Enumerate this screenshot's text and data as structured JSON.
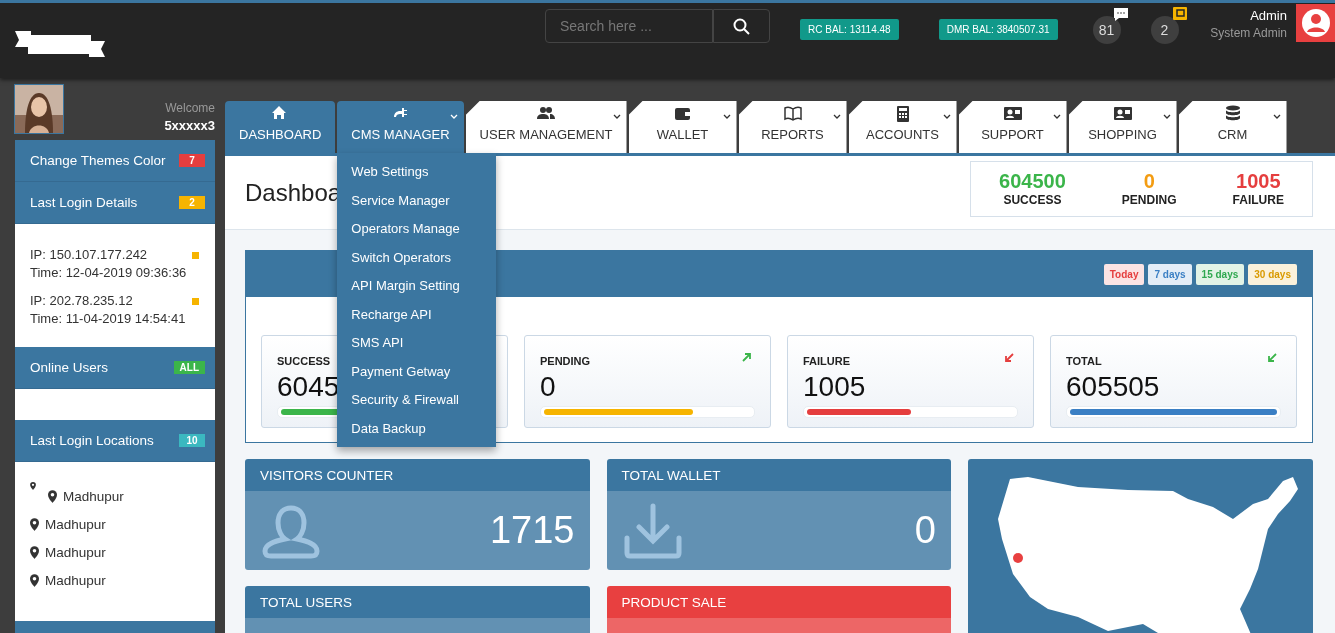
{
  "header": {
    "search": {
      "placeholder": "Search here ..."
    },
    "balances": [
      "RC BAL: 13114.48",
      "DMR BAL: 3840507.31"
    ],
    "notifications": [
      {
        "kind": "messages",
        "count": "81"
      },
      {
        "kind": "wallet",
        "count": "2"
      }
    ],
    "user": {
      "name": "Admin",
      "role": "System Admin"
    }
  },
  "sidebar": {
    "welcome": "Welcome",
    "username": "5xxxxx3",
    "panels": [
      {
        "title": "Change Themes Color",
        "badge": {
          "text": "7",
          "color": "#e53e3e"
        },
        "kind": "none"
      },
      {
        "title": "Last Login Details",
        "badge": {
          "text": "2",
          "color": "#f6b400"
        },
        "kind": "logins",
        "items": [
          {
            "ip": "IP: 150.107.177.242",
            "time": "Time: 12-04-2019 09:36:36",
            "color": "#f6b400"
          },
          {
            "ip": "IP: 202.78.235.12",
            "time": "Time: 11-04-2019 14:54:41",
            "color": "#f6b400"
          }
        ]
      },
      {
        "title": "Online Users",
        "badge": {
          "text": "ALL",
          "color": "#3bb54a"
        },
        "kind": "empty"
      },
      {
        "title": "Last Login Locations",
        "badge": {
          "text": "10",
          "color": "#3bb8c0"
        },
        "kind": "locations",
        "items": [
          {
            "place": "Madhupur",
            "kind": "wrapped"
          },
          {
            "place": "Madhupur",
            "kind": "plain"
          },
          {
            "place": "Madhupur",
            "kind": "plain"
          },
          {
            "place": "Madhupur",
            "kind": "plain"
          }
        ]
      }
    ]
  },
  "tabs": [
    {
      "label": "DASHBOARD",
      "selected": true
    },
    {
      "label": "CMS MANAGER",
      "selected": true,
      "menu": [
        "Web Settings",
        "Service Manager",
        "Operators Manage",
        "Switch Operators",
        "API Margin Setting",
        "Recharge API",
        "SMS API",
        "Payment Getway",
        "Security & Firewall",
        "Data Backup"
      ]
    },
    {
      "label": "USER MANAGEMENT",
      "selected": false
    },
    {
      "label": "WALLET",
      "selected": false
    },
    {
      "label": "REPORTS",
      "selected": false
    },
    {
      "label": "ACCOUNTS",
      "selected": false
    },
    {
      "label": "SUPPORT",
      "selected": false
    },
    {
      "label": "SHOPPING",
      "selected": false
    },
    {
      "label": "CRM",
      "selected": false
    }
  ],
  "page_title": "Dashboa",
  "summary": [
    {
      "value": "604500",
      "label": "SUCCESS",
      "color": "#3bb54a"
    },
    {
      "value": "0",
      "label": "PENDING",
      "color": "#f39c12"
    },
    {
      "value": "1005",
      "label": "FAILURE",
      "color": "#e53e3e"
    }
  ],
  "filters": [
    {
      "label": "Today",
      "color": "#e53e3e"
    },
    {
      "label": "7 days",
      "color": "#3a7fc4"
    },
    {
      "label": "15 days",
      "color": "#2fa84f"
    },
    {
      "label": "30 days",
      "color": "#d99a00"
    }
  ],
  "stat_cards": [
    {
      "label": "SUCCESS",
      "value": "6045",
      "color": "#3bb54a"
    },
    {
      "label": "PENDING",
      "value": "0",
      "level": 0.72,
      "color": "#f6b400"
    },
    {
      "label": "FAILURE",
      "value": "1005",
      "level": 0.5,
      "color": "#e53e3e"
    },
    {
      "label": "TOTAL",
      "value": "605505",
      "level": 1,
      "color": "#3a7fc4"
    }
  ],
  "tiles": [
    {
      "title": "VISITORS COUNTER",
      "value": "1715",
      "color": "#3b76a0"
    },
    {
      "title": "TOTAL WALLET",
      "value": "0",
      "color": "#3b76a0"
    },
    {
      "title": "TOTAL USERS",
      "color": "#3b76a0"
    },
    {
      "title": "PRODUCT SALE",
      "color": "#e84040"
    }
  ]
}
